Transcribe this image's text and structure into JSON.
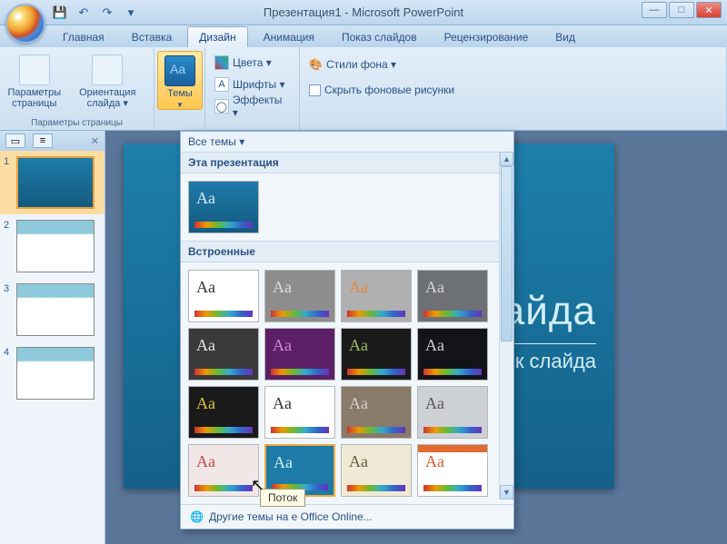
{
  "title": "Презентация1 - Microsoft PowerPoint",
  "qat": {
    "save": "💾",
    "undo": "↶",
    "redo": "↷",
    "more": "▾"
  },
  "win": {
    "min": "—",
    "max": "□",
    "close": "✕"
  },
  "tabs": [
    "Главная",
    "Вставка",
    "Дизайн",
    "Анимация",
    "Показ слайдов",
    "Рецензирование",
    "Вид"
  ],
  "active_tab": 2,
  "ribbon": {
    "page_params": {
      "label": "Параметры страницы",
      "page": "Параметры страницы",
      "orient": "Ориентация слайда ▾"
    },
    "themes_btn": "Темы",
    "colors": "Цвета ▾",
    "fonts": "Шрифты ▾",
    "effects": "Эффекты ▾",
    "bg_styles": "Стили фона ▾",
    "hide_bg": "Скрыть фоновые рисунки"
  },
  "slides": [
    "1",
    "2",
    "3",
    "4"
  ],
  "slide_title": "слайда",
  "slide_sub": "ловок слайда",
  "dropdown": {
    "all_themes": "Все темы ▾",
    "this_pres": "Эта презентация",
    "builtin": "Встроенные",
    "footer": "Другие темы на        е Office Online...",
    "tooltip": "Поток",
    "themes": [
      {
        "aa": "Aa",
        "bg": "#ffffff",
        "fg": "#333"
      },
      {
        "aa": "Aa",
        "bg": "#8d8d8d",
        "fg": "#ddd"
      },
      {
        "aa": "Aa",
        "bg": "#b0b0b0",
        "fg": "#e88a3c"
      },
      {
        "aa": "Aa",
        "bg": "#6d7074",
        "fg": "#d6d6d6"
      },
      {
        "aa": "Aa",
        "bg": "#3a3a3a",
        "fg": "#e5e5e5"
      },
      {
        "aa": "Aa",
        "bg": "#5c2066",
        "fg": "#d48ad2"
      },
      {
        "aa": "Aa",
        "bg": "#1a1a1a",
        "fg": "#9fbf5f"
      },
      {
        "aa": "Aa",
        "bg": "#12141a",
        "fg": "#cfcfcf"
      },
      {
        "aa": "Aa",
        "bg": "#1a1a1a",
        "fg": "#e2c23c"
      },
      {
        "aa": "Aa",
        "bg": "#ffffff",
        "fg": "#333"
      },
      {
        "aa": "Aa",
        "bg": "#8a7a6a",
        "fg": "#d6cfc6"
      },
      {
        "aa": "Aa",
        "bg": "#cdd0d4",
        "fg": "#555"
      },
      {
        "aa": "Aa",
        "bg": "#f2e7e7",
        "fg": "#c24a4a"
      },
      {
        "aa": "Aa",
        "bg": "#1e7ba8",
        "fg": "#cfeef8",
        "hover": true
      },
      {
        "aa": "Aa",
        "bg": "#efe9d6",
        "fg": "#6a5a40"
      },
      {
        "aa": "Aa",
        "bg": "#ffffff",
        "fg": "#d85a2a",
        "accent": "#e06a30"
      }
    ]
  }
}
